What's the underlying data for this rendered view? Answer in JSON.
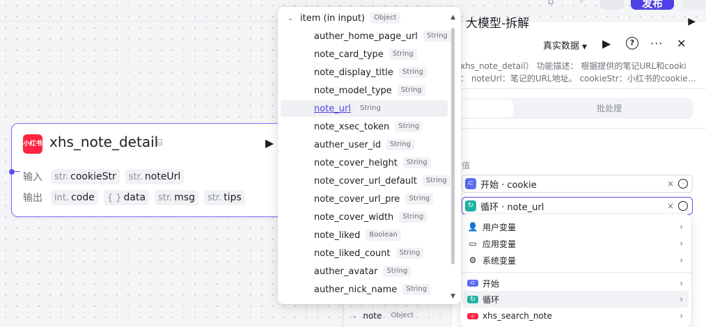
{
  "toolbar": {
    "publish_label": "发布"
  },
  "node": {
    "logo_text": "小红书",
    "title": "xhs_note_detail",
    "input_label": "输入",
    "output_label": "输出",
    "inputs": [
      {
        "type": "str.",
        "name": "cookieStr"
      },
      {
        "type": "str.",
        "name": "noteUrl"
      }
    ],
    "outputs": [
      {
        "type": "int.",
        "name": "code"
      },
      {
        "type": "{ }",
        "name": "data"
      },
      {
        "type": "str.",
        "name": "msg"
      },
      {
        "type": "str.",
        "name": "tips"
      }
    ]
  },
  "dropdown": {
    "parent": {
      "name": "item (in input)",
      "type": "Object"
    },
    "items": [
      {
        "name": "auther_home_page_url",
        "type": "String"
      },
      {
        "name": "note_card_type",
        "type": "String"
      },
      {
        "name": "note_display_title",
        "type": "String"
      },
      {
        "name": "note_model_type",
        "type": "String"
      },
      {
        "name": "note_url",
        "type": "String",
        "selected": true
      },
      {
        "name": "note_xsec_token",
        "type": "String"
      },
      {
        "name": "auther_user_id",
        "type": "String"
      },
      {
        "name": "note_cover_height",
        "type": "String"
      },
      {
        "name": "note_cover_url_default",
        "type": "String"
      },
      {
        "name": "note_cover_url_pre",
        "type": "String"
      },
      {
        "name": "note_cover_width",
        "type": "String"
      },
      {
        "name": "note_liked",
        "type": "Boolean"
      },
      {
        "name": "note_liked_count",
        "type": "String"
      },
      {
        "name": "auther_avatar",
        "type": "String"
      },
      {
        "name": "auther_nick_name",
        "type": "String"
      }
    ]
  },
  "panel": {
    "title": "大模型-拆解",
    "real_data_label": "真实数据",
    "desc_line1": "xhs_note_detail） 功能描述： 根据提供的笔记URL和cooki",
    "desc_line2": "： noteUrl：笔记的URL地址。 cookieStr：小红书的cookie…",
    "batch_label": "批处理",
    "value_label": "值",
    "ref1": "开始 · cookie",
    "ref2": "循环 · note_url"
  },
  "var_popup": {
    "items": [
      {
        "icon": "user-icon",
        "label": "用户变量"
      },
      {
        "icon": "folder-icon",
        "label": "应用变量"
      },
      {
        "icon": "gear-icon",
        "label": "系统变量"
      },
      {
        "icon": "start-icon",
        "label": "开始"
      },
      {
        "icon": "loop-icon",
        "label": "循环"
      },
      {
        "icon": "xhs-icon",
        "label": "xhs_search_note"
      }
    ]
  },
  "tree_below": {
    "name": "note",
    "type": "Object"
  },
  "colors": {
    "accent": "#4e40e5",
    "xhs_red": "#ff2442",
    "start_blue": "#5b6cf0",
    "loop_teal": "#1fb3a6"
  }
}
